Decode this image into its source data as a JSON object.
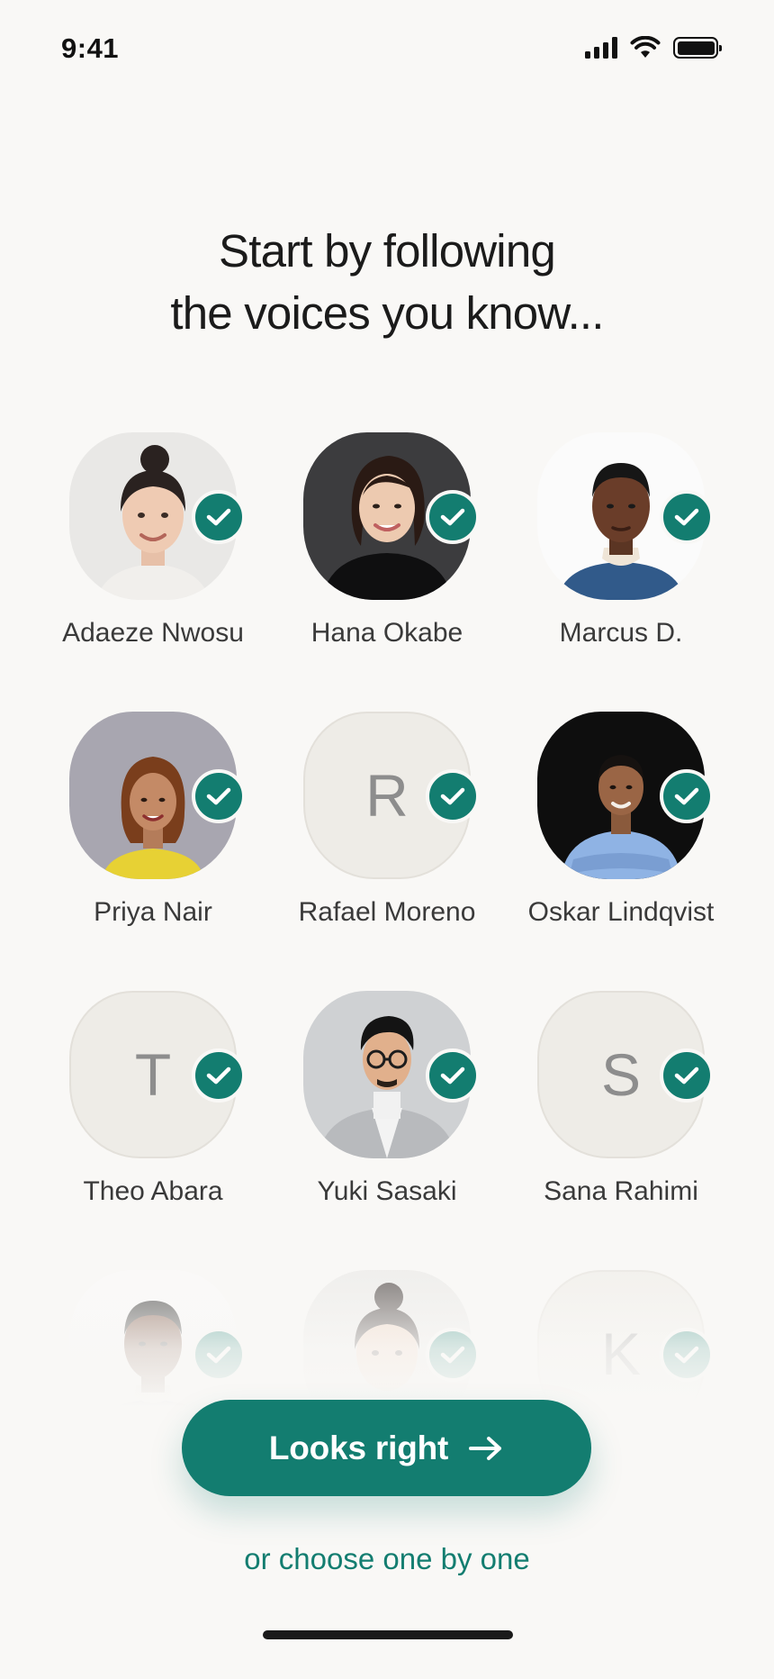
{
  "status_bar": {
    "time": "9:41"
  },
  "title": {
    "line1": "Start by following",
    "line2": "the voices you know..."
  },
  "people": [
    {
      "name": "Adaeze Nwosu",
      "selected": true,
      "avatar": "photo"
    },
    {
      "name": "Hana Okabe",
      "selected": true,
      "avatar": "photo"
    },
    {
      "name": "Marcus D.",
      "selected": true,
      "avatar": "photo"
    },
    {
      "name": "Priya Nair",
      "selected": true,
      "avatar": "photo"
    },
    {
      "name": "Rafael Moreno",
      "selected": true,
      "avatar": "letter",
      "initial": "R"
    },
    {
      "name": "Oskar Lindqvist",
      "selected": true,
      "avatar": "photo"
    },
    {
      "name": "Theo Abara",
      "selected": true,
      "avatar": "letter",
      "initial": "T"
    },
    {
      "name": "Yuki Sasaki",
      "selected": true,
      "avatar": "photo"
    },
    {
      "name": "Sana Rahimi",
      "selected": true,
      "avatar": "letter",
      "initial": "S"
    },
    {
      "selected": true,
      "avatar": "photo"
    },
    {
      "selected": true,
      "avatar": "photo"
    },
    {
      "selected": true,
      "avatar": "letter",
      "initial": "K"
    }
  ],
  "cta": {
    "label": "Looks right",
    "icon": "arrow-right-icon"
  },
  "secondary_link": "or choose one by one",
  "colors": {
    "accent": "#137d70",
    "background": "#f9f8f6"
  }
}
